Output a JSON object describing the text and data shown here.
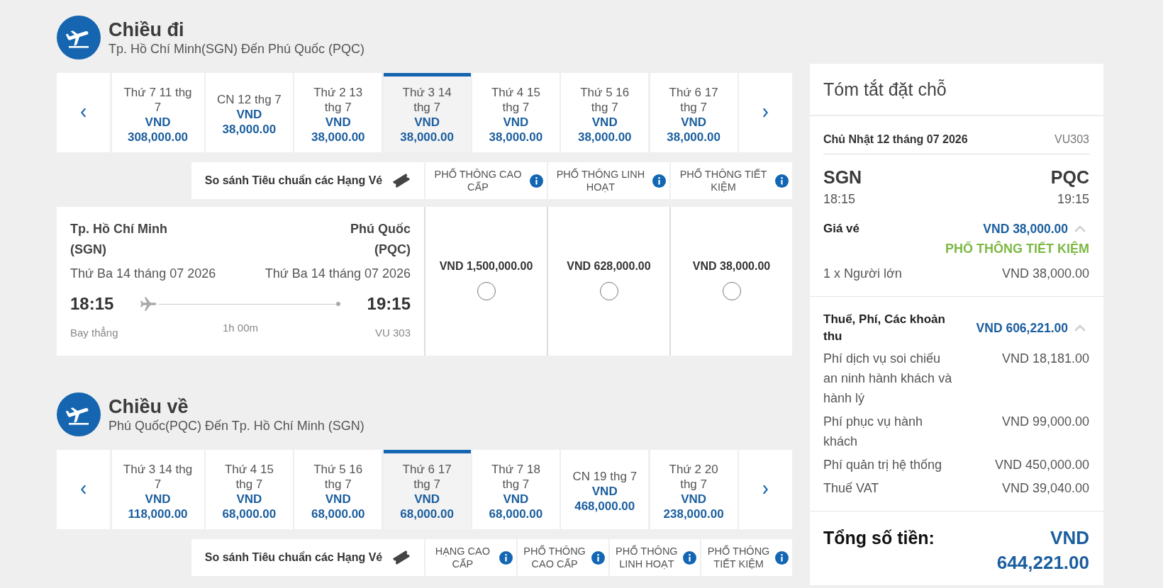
{
  "outbound": {
    "title": "Chiều đi",
    "route": "Tp. Hồ Chí Minh(SGN) Đến Phú Quốc (PQC)",
    "dates": [
      {
        "label": "Thứ 7 11 thg 7",
        "currency": "VND",
        "price": "308,000.00",
        "selected": false
      },
      {
        "label": "CN 12 thg 7",
        "currency": "VND",
        "price": "38,000.00",
        "selected": false
      },
      {
        "label": "Thứ 2 13 thg 7",
        "currency": "VND",
        "price": "38,000.00",
        "selected": false
      },
      {
        "label": "Thứ 3 14 thg 7",
        "currency": "VND",
        "price": "38,000.00",
        "selected": true
      },
      {
        "label": "Thứ 4 15 thg 7",
        "currency": "VND",
        "price": "38,000.00",
        "selected": false
      },
      {
        "label": "Thứ 5 16 thg 7",
        "currency": "VND",
        "price": "38,000.00",
        "selected": false
      },
      {
        "label": "Thứ 6 17 thg 7",
        "currency": "VND",
        "price": "38,000.00",
        "selected": false
      }
    ],
    "compare": {
      "label": "So sánh Tiêu chuẩn các Hạng Vé",
      "fare_classes": [
        "PHỔ THÔNG CAO CẤP",
        "PHỔ THÔNG LINH HOẠT",
        "PHỔ THÔNG TIẾT KIỆM"
      ]
    },
    "flight": {
      "origin_city": "Tp. Hồ Chí Minh",
      "origin_code": "(SGN)",
      "destination_city": "Phú Quốc",
      "destination_code": "(PQC)",
      "departure_date": "Thứ Ba 14 tháng 07 2026",
      "arrival_date": "Thứ Ba 14 tháng 07 2026",
      "departure_time": "18:15",
      "arrival_time": "19:15",
      "stops": "Bay thẳng",
      "duration": "1h 00m",
      "flight_number": "VU 303",
      "fares": [
        {
          "price": "VND 1,500,000.00",
          "selected": false
        },
        {
          "price": "VND 628,000.00",
          "selected": false
        },
        {
          "price": "VND 38,000.00",
          "selected": false
        }
      ]
    }
  },
  "inbound": {
    "title": "Chiều về",
    "route": "Phú Quốc(PQC) Đến Tp. Hồ Chí Minh (SGN)",
    "dates": [
      {
        "label": "Thứ 3 14 thg 7",
        "currency": "VND",
        "price": "118,000.00",
        "selected": false
      },
      {
        "label": "Thứ 4 15 thg 7",
        "currency": "VND",
        "price": "68,000.00",
        "selected": false
      },
      {
        "label": "Thứ 5 16 thg 7",
        "currency": "VND",
        "price": "68,000.00",
        "selected": false
      },
      {
        "label": "Thứ 6 17 thg 7",
        "currency": "VND",
        "price": "68,000.00",
        "selected": true
      },
      {
        "label": "Thứ 7 18 thg 7",
        "currency": "VND",
        "price": "68,000.00",
        "selected": false
      },
      {
        "label": "CN 19 thg 7",
        "currency": "VND",
        "price": "468,000.00",
        "selected": false
      },
      {
        "label": "Thứ 2 20 thg 7",
        "currency": "VND",
        "price": "238,000.00",
        "selected": false
      }
    ],
    "compare": {
      "label": "So sánh Tiêu chuẩn các Hạng Vé",
      "fare_classes": [
        "HẠNG CAO CẤP",
        "PHỔ THÔNG CAO CẤP",
        "PHỔ THÔNG LINH HOẠT",
        "PHỔ THÔNG TIẾT KIỆM"
      ]
    }
  },
  "summary": {
    "title": "Tóm tắt đặt chỗ",
    "date": "Chủ Nhật 12 tháng 07 2026",
    "flight_number": "VU303",
    "origin": "SGN",
    "destination": "PQC",
    "departure_time": "18:15",
    "arrival_time": "19:15",
    "fare": {
      "label": "Giá vé",
      "amount": "VND 38,000.00",
      "expanded": true,
      "fare_class": "PHỔ THÔNG TIẾT KIỆM",
      "items": [
        {
          "label": "1 x Người lớn",
          "amount": "VND 38,000.00"
        }
      ]
    },
    "taxes": {
      "label": "Thuế, Phí, Các khoản thu",
      "amount": "VND 606,221.00",
      "expanded": true,
      "items": [
        {
          "label": "Phí dịch vụ soi chiếu an ninh hành khách và hành lý",
          "amount": "VND 18,181.00"
        },
        {
          "label": "Phí phục vụ hành khách",
          "amount": "VND 99,000.00"
        },
        {
          "label": "Phí quản trị hệ thống",
          "amount": "VND 450,000.00"
        },
        {
          "label": "Thuế VAT",
          "amount": "VND 39,040.00"
        }
      ]
    },
    "total": {
      "label": "Tổng số tiền:",
      "currency": "VND",
      "amount": "644,221.00"
    }
  }
}
